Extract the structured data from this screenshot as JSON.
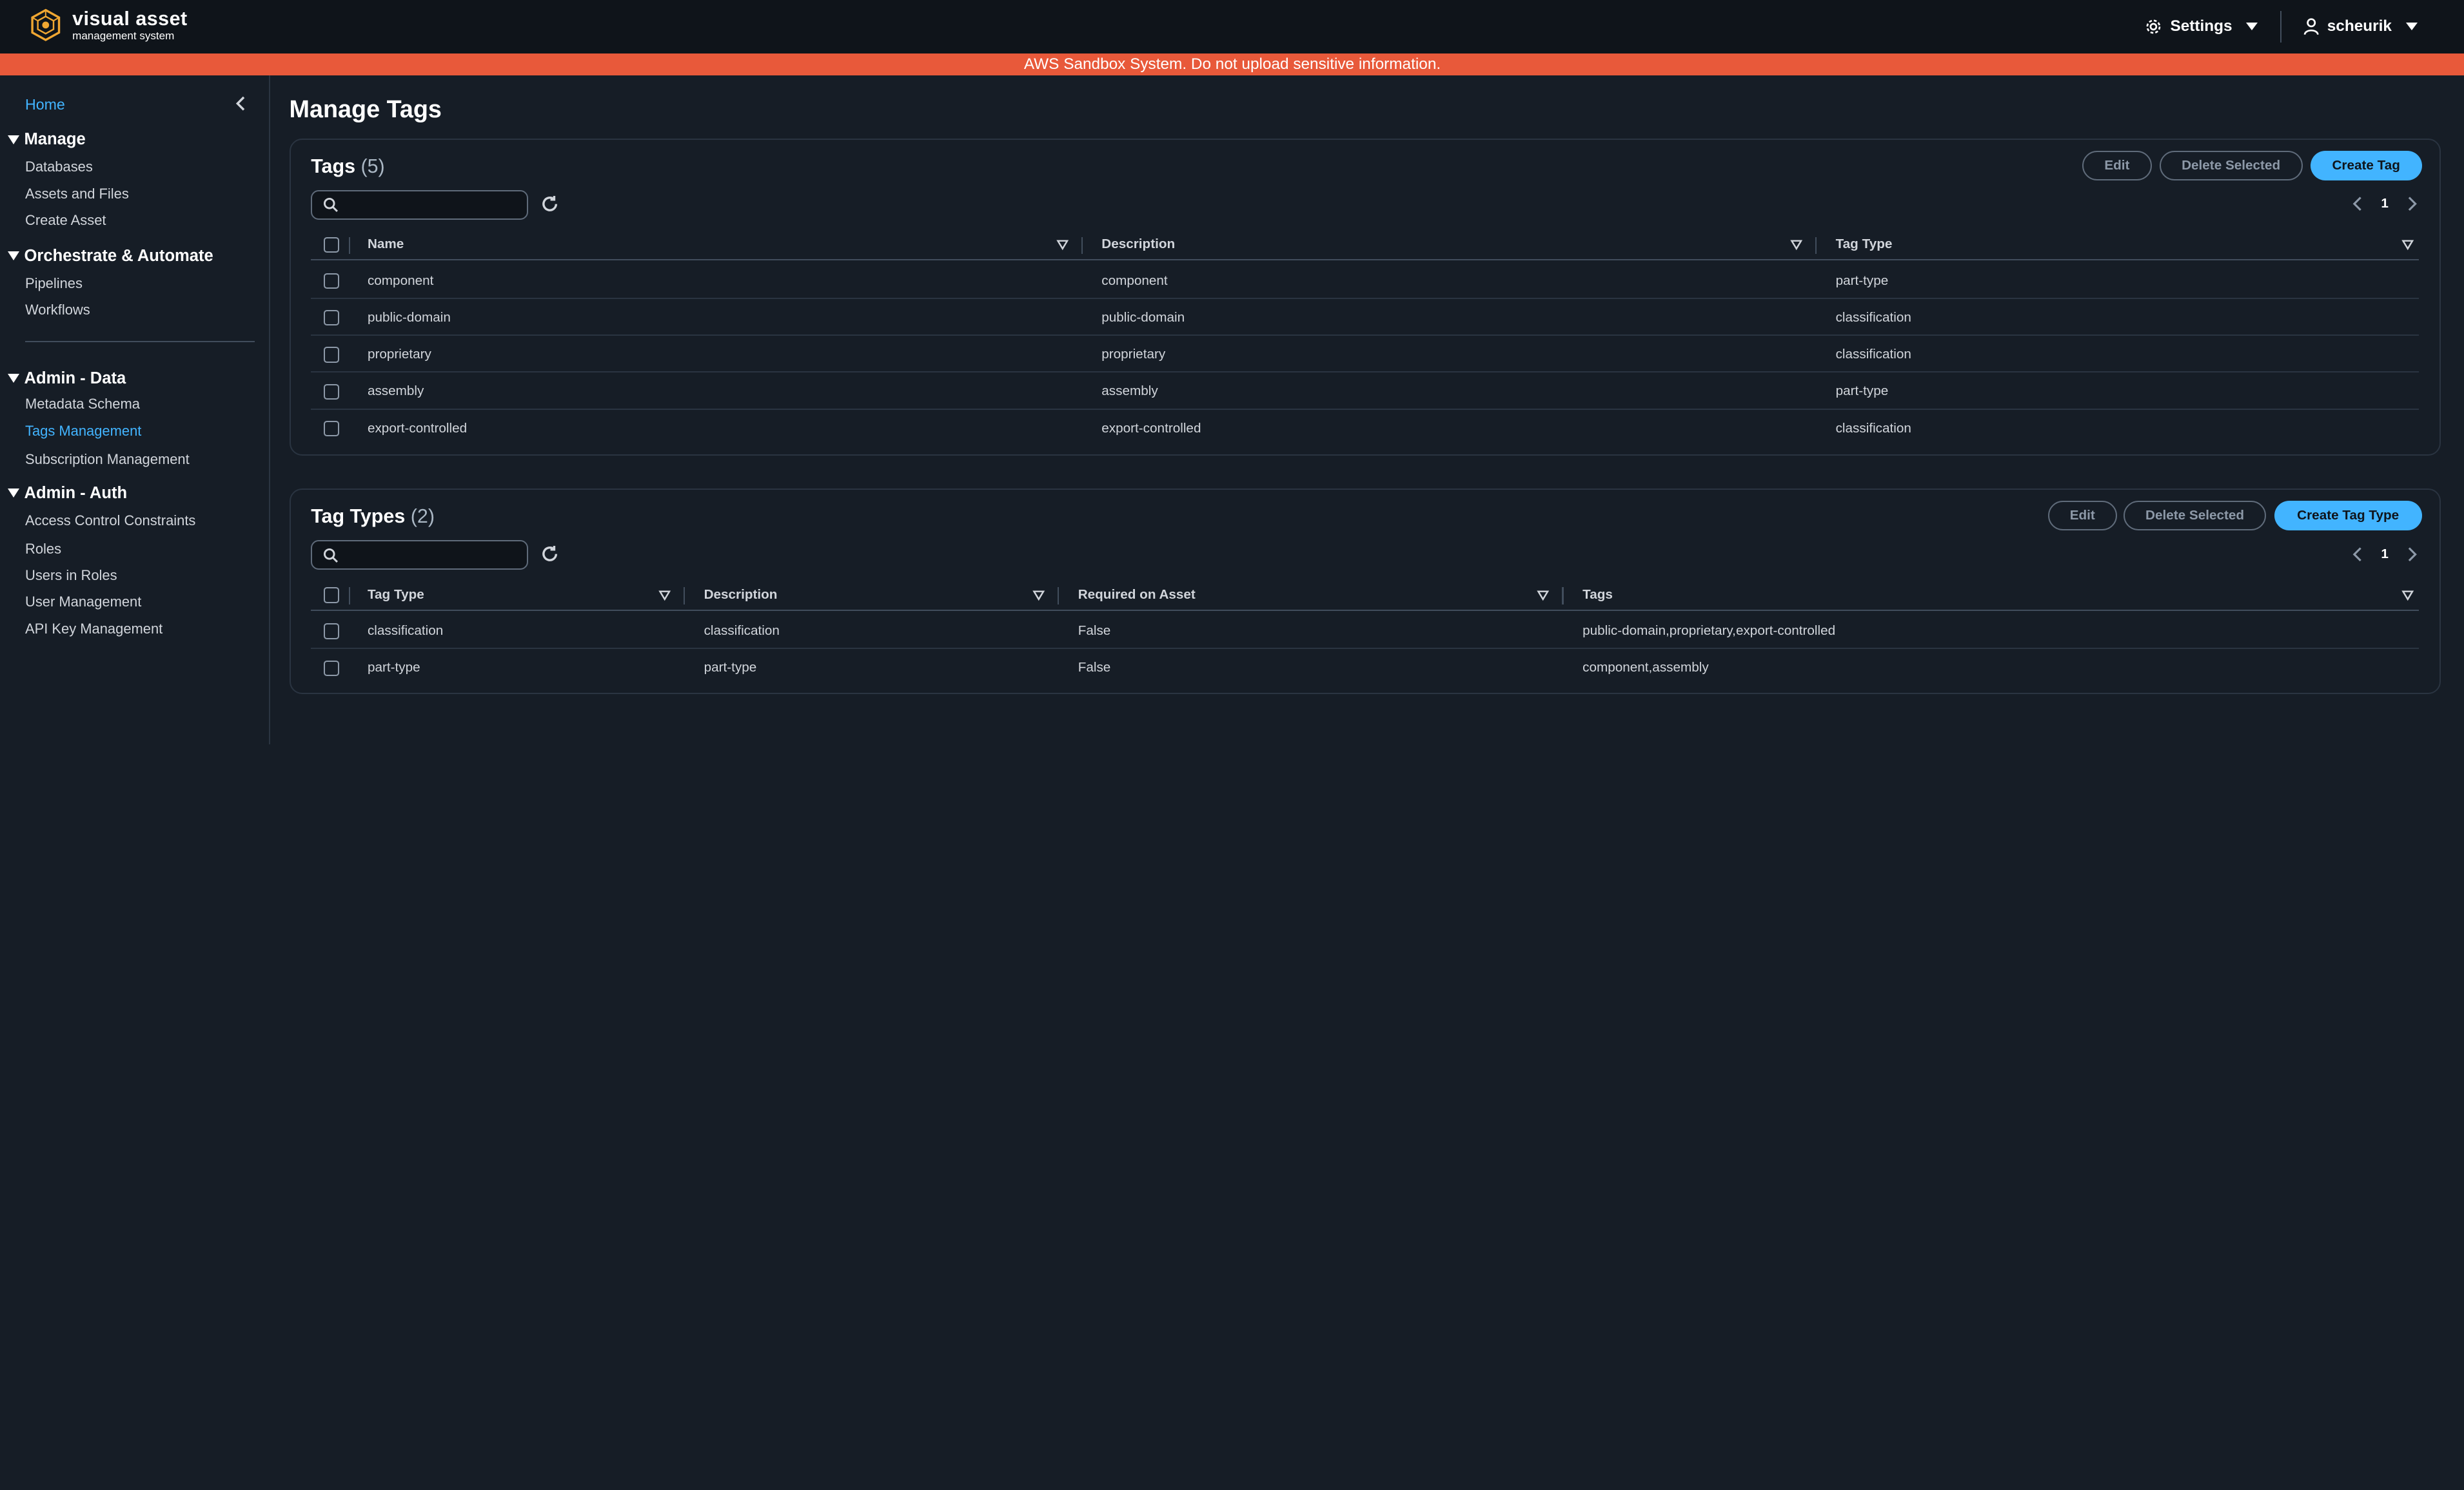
{
  "app": {
    "logo_title": "visual asset",
    "logo_subtitle": "management system",
    "settings_label": "Settings",
    "user_label": "scheurik"
  },
  "banner": {
    "text": "AWS Sandbox System. Do not upload sensitive information."
  },
  "sidebar": {
    "home": "Home",
    "sections": [
      {
        "title": "Manage",
        "items": [
          "Databases",
          "Assets and Files",
          "Create Asset"
        ]
      },
      {
        "title": "Orchestrate & Automate",
        "items": [
          "Pipelines",
          "Workflows"
        ]
      },
      {
        "title": "Admin - Data",
        "items": [
          "Metadata Schema",
          "Tags Management",
          "Subscription Management"
        ]
      },
      {
        "title": "Admin - Auth",
        "items": [
          "Access Control Constraints",
          "Roles",
          "Users in Roles",
          "User Management",
          "API Key Management"
        ]
      }
    ],
    "active_item": "Tags Management"
  },
  "page": {
    "title": "Manage Tags"
  },
  "tags": {
    "title": "Tags",
    "count": "(5)",
    "buttons": {
      "edit": "Edit",
      "delete": "Delete Selected",
      "create": "Create Tag"
    },
    "search": {
      "placeholder": "",
      "value": ""
    },
    "page": "1",
    "columns": [
      "Name",
      "Description",
      "Tag Type"
    ],
    "rows": [
      [
        "component",
        "component",
        "part-type"
      ],
      [
        "public-domain",
        "public-domain",
        "classification"
      ],
      [
        "proprietary",
        "proprietary",
        "classification"
      ],
      [
        "assembly",
        "assembly",
        "part-type"
      ],
      [
        "export-controlled",
        "export-controlled",
        "classification"
      ]
    ]
  },
  "tag_types": {
    "title": "Tag Types",
    "count": "(2)",
    "buttons": {
      "edit": "Edit",
      "delete": "Delete Selected",
      "create": "Create Tag Type"
    },
    "search": {
      "placeholder": "",
      "value": ""
    },
    "page": "1",
    "columns": [
      "Tag Type",
      "Description",
      "Required on Asset",
      "Tags"
    ],
    "rows": [
      [
        "classification",
        "classification",
        "False",
        "public-domain,proprietary,export-controlled"
      ],
      [
        "part-type",
        "part-type",
        "False",
        "component,assembly"
      ]
    ]
  },
  "colors": {
    "accent": "#42b4ff",
    "banner": "#e8593a",
    "background": "#161d26",
    "topnav": "#0f141a"
  }
}
